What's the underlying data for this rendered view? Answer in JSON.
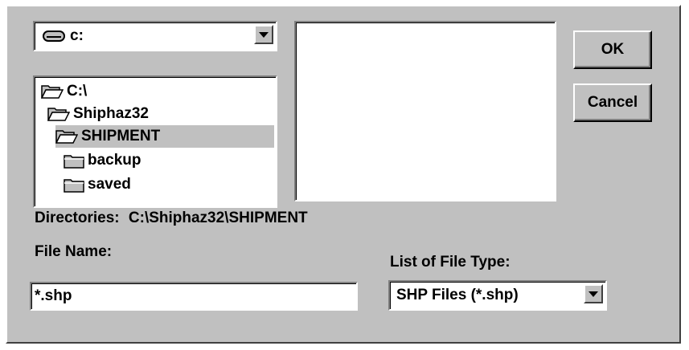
{
  "drive": {
    "value": "c:",
    "icon": "drive-icon"
  },
  "directories": {
    "items": [
      {
        "label": "C:\\",
        "icon": "open-folder-icon",
        "selected": false
      },
      {
        "label": "Shiphaz32",
        "icon": "open-folder-icon",
        "selected": false
      },
      {
        "label": "SHIPMENT",
        "icon": "open-folder-icon",
        "selected": true
      },
      {
        "label": "backup",
        "icon": "folder-icon",
        "selected": false
      },
      {
        "label": "saved",
        "icon": "folder-icon",
        "selected": false
      }
    ],
    "caption": "Directories:",
    "path": "C:\\Shiphaz32\\SHIPMENT"
  },
  "buttons": {
    "ok": "OK",
    "cancel": "Cancel"
  },
  "file_name": {
    "label": "File Name:",
    "value": "*.shp"
  },
  "file_type": {
    "label": "List of File Type:",
    "value": "SHP Files (*.shp)"
  },
  "colors": {
    "face": "#c0c0c0",
    "shadow": "#808080",
    "highlight": "#ffffff",
    "window": "#ffffff"
  }
}
